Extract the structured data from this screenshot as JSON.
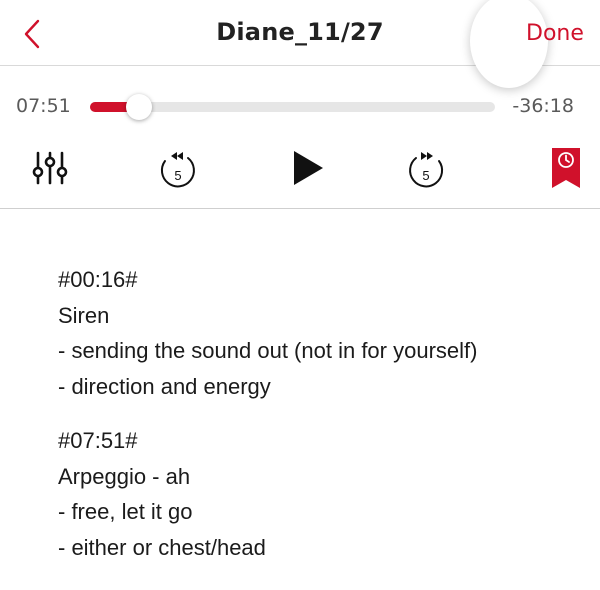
{
  "header": {
    "title": "Diane_11/27",
    "done_label": "Done",
    "back_icon": "chevron-left-icon"
  },
  "colors": {
    "accent": "#d0112b",
    "track": "#e6e6e6",
    "text": "#1b1b1b",
    "muted": "#5a5a5a"
  },
  "player": {
    "elapsed": "07:51",
    "remaining": "-36:18",
    "progress_fraction": 0.12,
    "skip_back_seconds": "5",
    "skip_forward_seconds": "5",
    "icons": {
      "equalizer": "sliders-icon",
      "rewind": "skip-back-5-icon",
      "play": "play-icon",
      "forward": "skip-forward-5-icon",
      "bookmark": "bookmark-clock-icon"
    }
  },
  "notes": [
    {
      "timestamp": "#00:16#",
      "lines": [
        "Siren",
        "- sending the sound out (not in for yourself)",
        "- direction and energy"
      ]
    },
    {
      "timestamp": "#07:51#",
      "lines": [
        "Arpeggio - ah",
        "- free, let it go",
        "- either or chest/head"
      ]
    }
  ]
}
